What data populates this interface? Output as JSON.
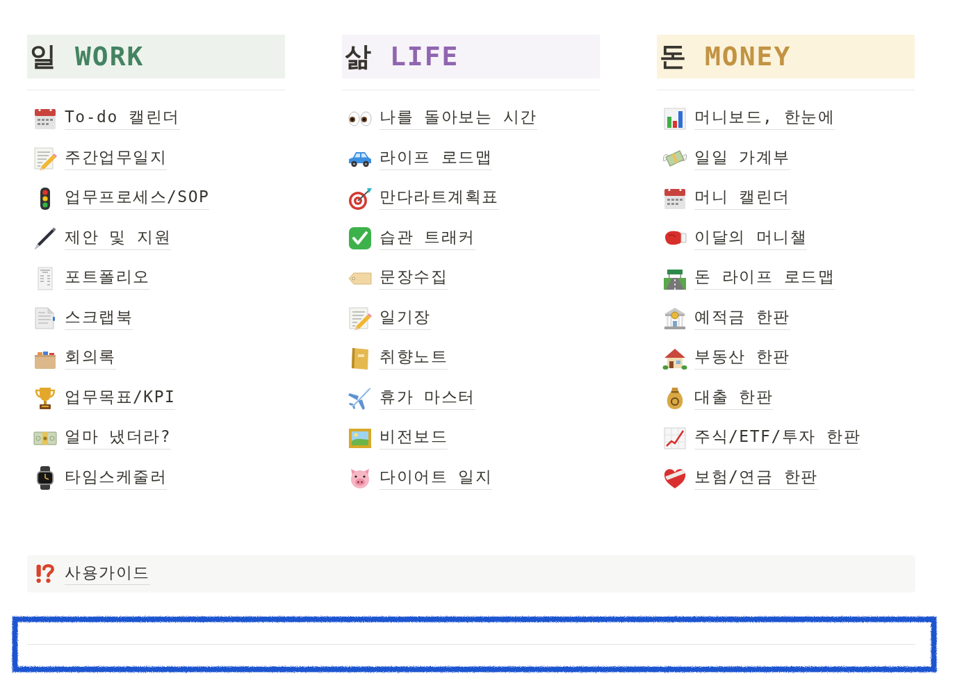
{
  "columns": [
    {
      "heading": {
        "hangul": "일",
        "english": "WORK",
        "color": "#448361"
      },
      "color": "#edf3ec",
      "items": [
        {
          "label": "To-do 캘린더"
        },
        {
          "label": "주간업무일지"
        },
        {
          "label": "업무프로세스/SOP"
        },
        {
          "label": "제안 및 지원"
        },
        {
          "label": "포트폴리오"
        },
        {
          "label": "스크랩북"
        },
        {
          "label": "회의록"
        },
        {
          "label": "업무목표/KPI"
        },
        {
          "label": "얼마 냈더라?"
        },
        {
          "label": "타임스케줄러"
        }
      ]
    },
    {
      "heading": {
        "hangul": "삶",
        "english": "LIFE",
        "color": "#9065b0"
      },
      "color": "#f6f3f9",
      "items": [
        {
          "label": "나를 돌아보는 시간"
        },
        {
          "label": "라이프 로드맵"
        },
        {
          "label": "만다라트계획표"
        },
        {
          "label": "습관 트래커"
        },
        {
          "label": "문장수집"
        },
        {
          "label": "일기장"
        },
        {
          "label": "취향노트"
        },
        {
          "label": "휴가 마스터"
        },
        {
          "label": "비전보드"
        },
        {
          "label": "다이어트 일지"
        }
      ]
    },
    {
      "heading": {
        "hangul": "돈",
        "english": "MONEY",
        "color": "#c29343"
      },
      "color": "#fbf3db",
      "items": [
        {
          "label": "머니보드, 한눈에"
        },
        {
          "label": "일일 가계부"
        },
        {
          "label": "머니 캘린더"
        },
        {
          "label": "이달의 머니챌"
        },
        {
          "label": "돈 라이프 로드맵"
        },
        {
          "label": "예적금 한판"
        },
        {
          "label": "부동산 한판"
        },
        {
          "label": "대출 한판"
        },
        {
          "label": "주식/ETF/투자 한판"
        },
        {
          "label": "보험/연금 한판"
        }
      ]
    }
  ],
  "callout": {
    "label": "사용가이드"
  },
  "divider_block": {
    "highlighted": true
  }
}
